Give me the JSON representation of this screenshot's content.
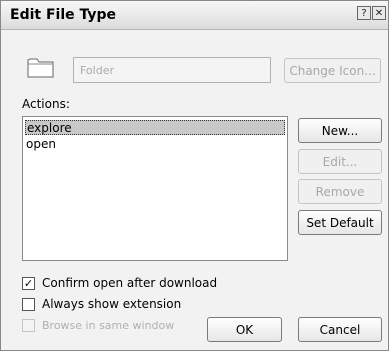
{
  "window": {
    "title": "Edit File Type",
    "help_label": "?",
    "close_label": "✕"
  },
  "file_type": {
    "icon": "folder-icon",
    "name_value": "Folder",
    "change_icon_label": "Change Icon..."
  },
  "actions": {
    "label": "Actions:",
    "items": [
      {
        "label": "explore",
        "selected": true
      },
      {
        "label": "open",
        "selected": false
      }
    ],
    "new_label": "New...",
    "edit_label": "Edit...",
    "remove_label": "Remove",
    "set_default_label": "Set Default"
  },
  "options": {
    "confirm_open": {
      "label": "Confirm open after download",
      "checked": true
    },
    "always_show_ext": {
      "label": "Always show extension",
      "checked": false
    },
    "browse_same_window": {
      "label": "Browse in same window",
      "checked": false,
      "disabled": true
    }
  },
  "footer": {
    "ok_label": "OK",
    "cancel_label": "Cancel"
  }
}
